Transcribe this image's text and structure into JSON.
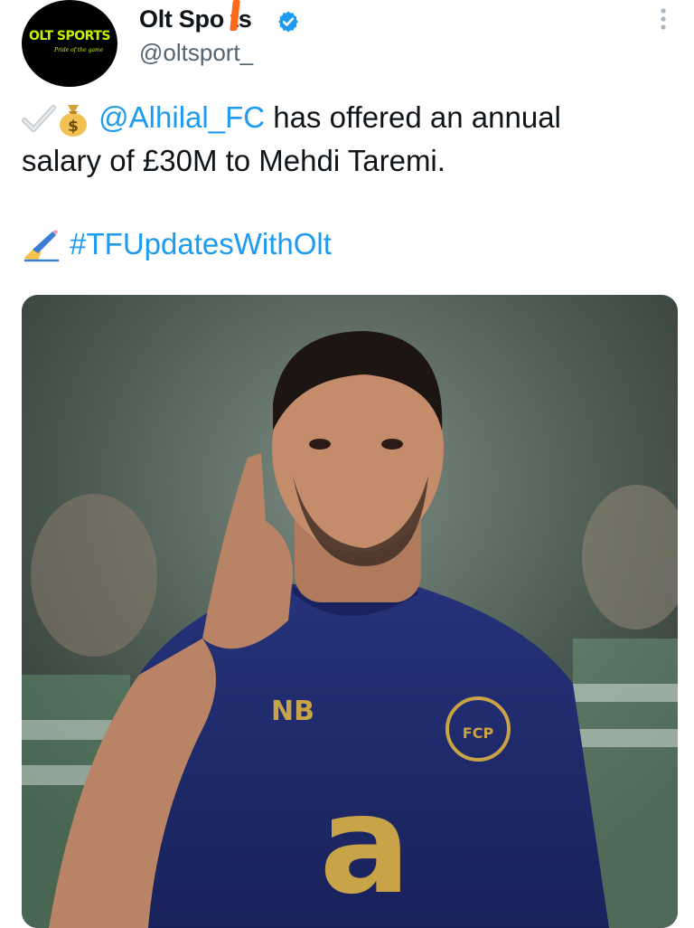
{
  "header": {
    "avatar_logo": "OLT SPORTS",
    "avatar_tagline": "Pride of the game",
    "display_name": "Olt Spo ts",
    "handle": "@oltsport_"
  },
  "tweet": {
    "mention": "@Alhilal_FC",
    "body_line1_rest": " has offered an annual",
    "body_line2": "salary of £30M to Mehdi Taremi.",
    "hashtag": "#TFUpdatesWithOlt"
  },
  "media": {
    "jersey_sponsor": "a",
    "jersey_brand": "NB",
    "crest_letters": "FCP"
  },
  "colors": {
    "link": "#1d9bf0",
    "verified": "#1d9bf0",
    "handle": "#536471",
    "avatar_logo": "#c6f200",
    "shirt_navy": "#1f2a6b",
    "sponsor_gold": "#c9a347"
  },
  "icons": {
    "verified": "verified-badge-icon",
    "more": "more-vertical-icon",
    "check": "check-mark-icon",
    "money_bag": "money-bag-icon",
    "writing_hand": "writing-hand-icon"
  }
}
